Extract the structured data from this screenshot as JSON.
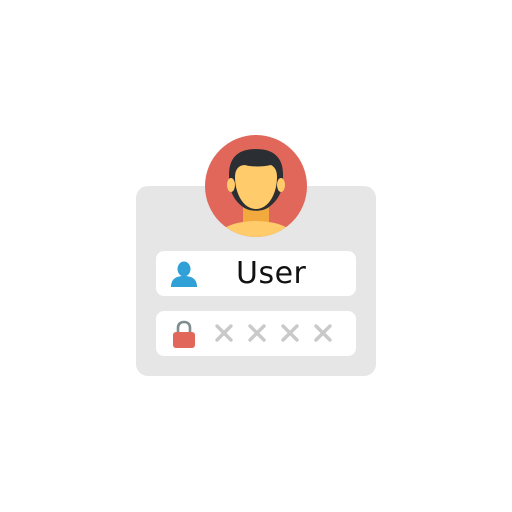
{
  "colors": {
    "card_background": "#e6e6e6",
    "field_background": "#ffffff",
    "avatar_circle": "#e0675a",
    "hair": "#2b2f33",
    "skin": "#ffcb6b",
    "neck_shirt": "#f2aa3f",
    "user_icon": "#2fa1d6",
    "lock_body": "#e0675a",
    "lock_shackle": "#7f8c8d",
    "mask_glyph": "#c9c9c9"
  },
  "login": {
    "avatar_icon": "user-avatar-icon",
    "username": {
      "icon": "user-icon",
      "value": "User"
    },
    "password": {
      "icon": "lock-icon",
      "masked_characters": 4,
      "mask_glyph": "×"
    }
  }
}
